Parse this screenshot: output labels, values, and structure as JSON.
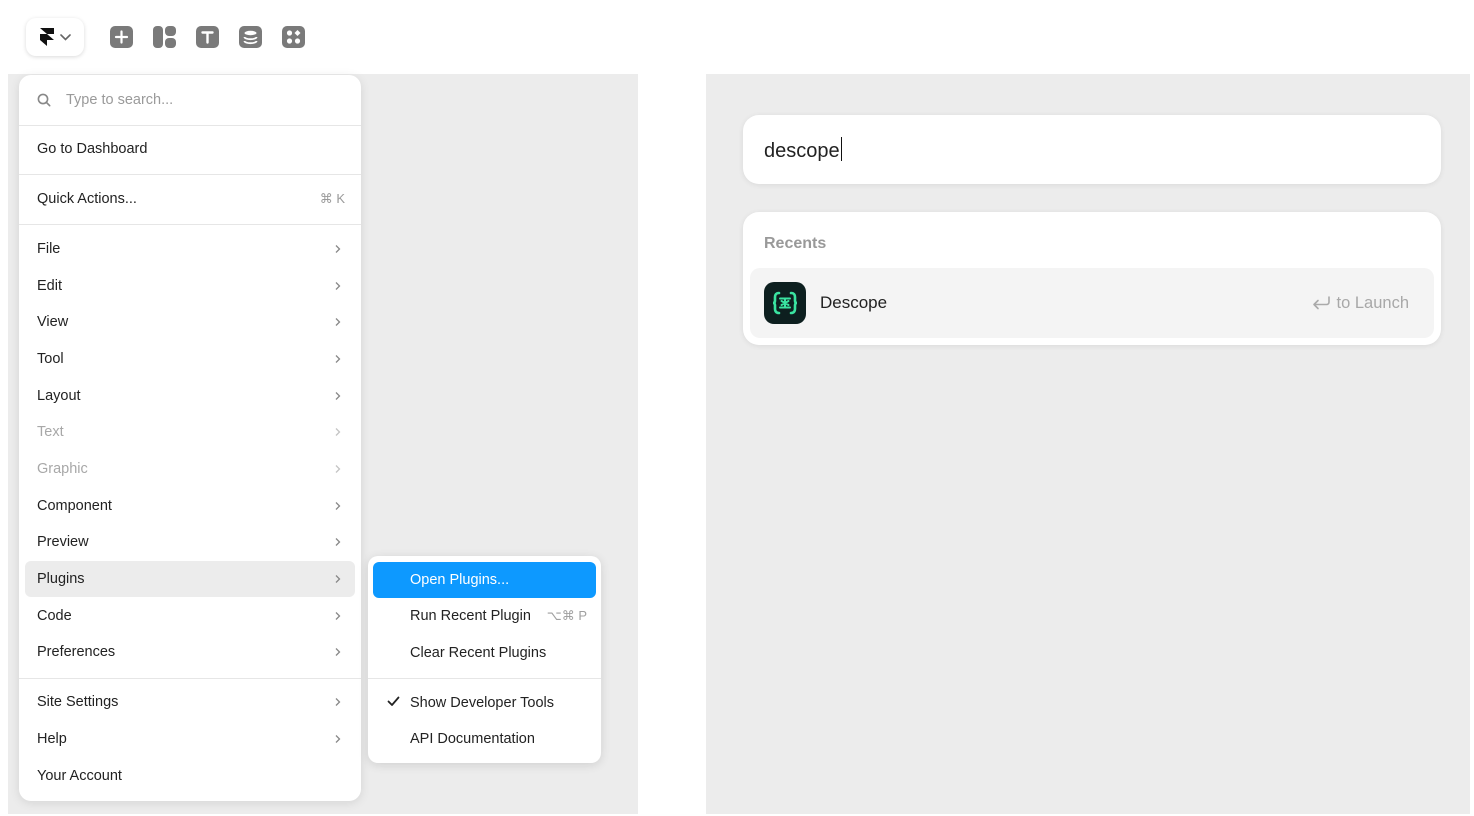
{
  "toolbar": {
    "icons": [
      "framer-logo-icon",
      "chevron-down-icon",
      "insert-icon",
      "layout-icon",
      "text-icon",
      "cms-icon",
      "assets-icon"
    ]
  },
  "menu": {
    "search_placeholder": "Type to search...",
    "dashboard": "Go to Dashboard",
    "quick_actions": "Quick Actions...",
    "quick_actions_shortcut": "⌘ K",
    "items": [
      "File",
      "Edit",
      "View",
      "Tool",
      "Layout",
      "Text",
      "Graphic",
      "Component",
      "Preview",
      "Plugins",
      "Code",
      "Preferences"
    ],
    "bottom_items": [
      "Site Settings",
      "Help",
      "Your Account"
    ]
  },
  "submenu": {
    "open_plugins": "Open Plugins...",
    "run_recent": "Run Recent Plugin",
    "run_recent_shortcut": "⌥⌘ P",
    "clear_recent": "Clear Recent Plugins",
    "dev_tools": "Show Developer Tools",
    "api_docs": "API Documentation"
  },
  "launcher": {
    "query": "descope",
    "recents_heading": "Recents",
    "result_name": "Descope",
    "result_hint": "to Launch"
  },
  "colors": {
    "accent": "#0d99ff",
    "canvas": "#ececec",
    "icon_gray": "#7a7a7a",
    "descope_green": "#3ae3a0"
  }
}
